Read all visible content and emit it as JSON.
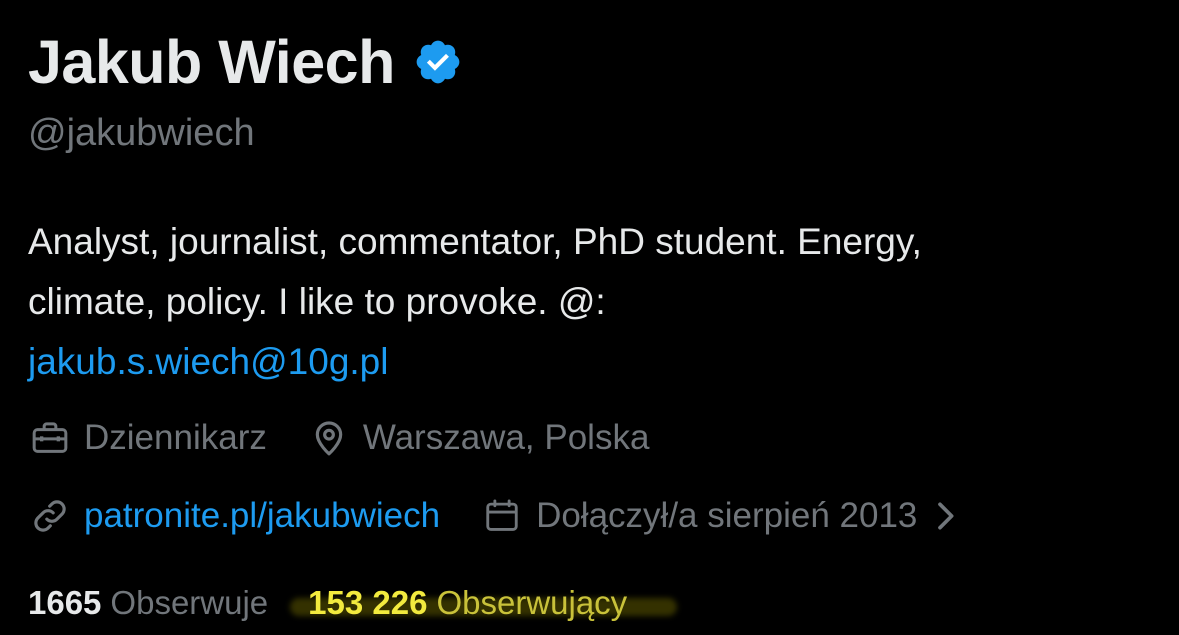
{
  "profile": {
    "display_name": "Jakub Wiech",
    "verified": true,
    "verified_icon": "verified-badge-icon",
    "handle": "@jakubwiech",
    "bio": {
      "line1": "Analyst, journalist, commentator, PhD student. Energy,",
      "line2": "climate, policy. I like to provoke. @:",
      "email": "jakub.s.wiech@10g.pl"
    },
    "meta": {
      "profession": "Dziennikarz",
      "profession_icon": "briefcase-icon",
      "location": "Warszawa, Polska",
      "location_icon": "location-pin-icon",
      "website": "patronite.pl/jakubwiech",
      "website_icon": "link-icon",
      "joined": "Dołączył/a sierpień 2013",
      "joined_icon": "calendar-icon"
    },
    "stats": {
      "following_count": "1665",
      "following_label": "Obserwuje",
      "followers_count": "153 226",
      "followers_label": "Obserwujący"
    }
  },
  "colors": {
    "background": "#000000",
    "primary_text": "#e7e9ea",
    "secondary_text": "#71767b",
    "link": "#1d9bf0",
    "verified": "#1d9bf0",
    "highlight": "#f2ea3e"
  }
}
